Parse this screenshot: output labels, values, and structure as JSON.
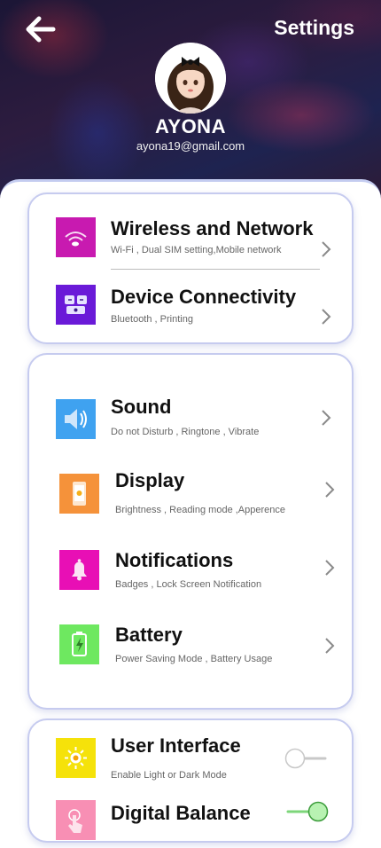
{
  "header": {
    "title": "Settings",
    "user_name": "AYONA",
    "user_email": "ayona19@gmail.com"
  },
  "groups": [
    {
      "items": [
        {
          "title": "Wireless and Network",
          "subtitle": "Wi-Fi , Dual SIM setting,Mobile network",
          "icon": "wifi-icon",
          "color": "#c81ab0"
        },
        {
          "title": "Device Connectivity",
          "subtitle": "Bluetooth , Printing",
          "icon": "device-connect-icon",
          "color": "#6a1ad8"
        }
      ]
    },
    {
      "items": [
        {
          "title": "Sound",
          "subtitle": "Do not Disturb , Ringtone , Vibrate",
          "icon": "speaker-icon",
          "color": "#3fa2f0"
        },
        {
          "title": "Display",
          "subtitle": "Brightness , Reading mode ,Apperence",
          "icon": "phone-display-icon",
          "color": "#f5923a"
        },
        {
          "title": "Notifications",
          "subtitle": "Badges , Lock Screen Notification",
          "icon": "bell-icon",
          "color": "#e80fb5"
        },
        {
          "title": "Battery",
          "subtitle": "Power Saving Mode , Battery Usage",
          "icon": "battery-icon",
          "color": "#6ee860"
        }
      ]
    },
    {
      "items": [
        {
          "title": "User Interface",
          "subtitle": "Enable Light or Dark Mode",
          "icon": "sun-icon",
          "color": "#f5e20a",
          "toggle": false
        },
        {
          "title": "Digital Balance",
          "subtitle": "",
          "icon": "touch-icon",
          "color": "#f88fb4",
          "toggle": true
        }
      ]
    }
  ],
  "colors": {
    "accent": "#c6cbef",
    "toggle_on": "#7dd67a"
  }
}
